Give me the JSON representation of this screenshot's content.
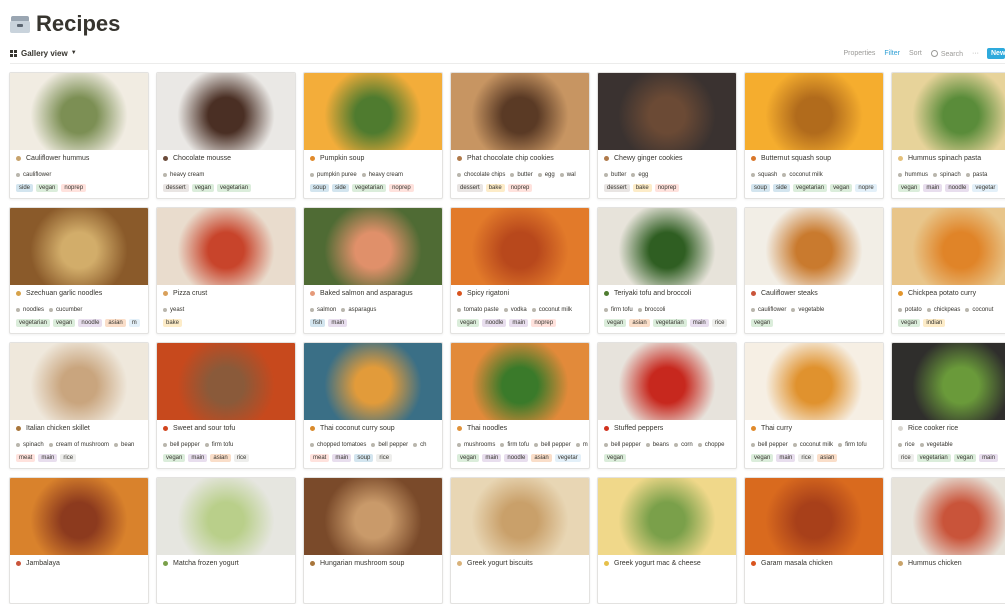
{
  "page": {
    "title": "Recipes",
    "icon": "file-cabinet-icon"
  },
  "toolbar": {
    "view_label": "Gallery view",
    "properties": "Properties",
    "filter": "Filter",
    "sort": "Sort",
    "search": "Search",
    "more": "···",
    "new": "New"
  },
  "colors": {
    "accent": "#2eaadc",
    "filter_active": "#2e9fd4"
  },
  "tag_colors": {
    "side": "#d3e5ef",
    "vegan": "#dbeddb",
    "noprep": "#ffe2dd",
    "dessert": "#e9e5e3",
    "vegetarian": "#dbeddb",
    "soup": "#d3e5ef",
    "bake": "#fdecc8",
    "noodle": "#e8deee",
    "asian": "#fadec9",
    "main": "#e8deee",
    "fish": "#d3e5ef",
    "rice": "#eeeeec",
    "indian": "#fdecc8",
    "meat": "#ffe2dd"
  },
  "cards": [
    {
      "title": "Cauliflower hummus",
      "icon_color": "#c7a36d",
      "img": [
        "#f1ece2",
        "#7c8f54"
      ],
      "ingredients": [
        "cauliflower"
      ],
      "tags": [
        "side",
        "vegan",
        "noprep"
      ]
    },
    {
      "title": "Chocolate mousse",
      "icon_color": "#6b4b3a",
      "img": [
        "#eae8e5",
        "#4a2f24"
      ],
      "ingredients": [
        "heavy cream"
      ],
      "tags": [
        "dessert",
        "vegan",
        "vegetarian"
      ]
    },
    {
      "title": "Pumpkin soup",
      "icon_color": "#e08a2c",
      "img": [
        "#f3ad3a",
        "#4f7b2f"
      ],
      "ingredients": [
        "pumpkin puree",
        "heavy cream"
      ],
      "tags": [
        "soup",
        "side",
        "vegetarian",
        "noprep"
      ]
    },
    {
      "title": "Phat chocolate chip cookies",
      "icon_color": "#b07a4a",
      "img": [
        "#c79562",
        "#5a3a25"
      ],
      "ingredients": [
        "chocolate chips",
        "butter",
        "egg",
        "wal"
      ],
      "tags": [
        "dessert",
        "bake",
        "noprep"
      ]
    },
    {
      "title": "Chewy ginger cookies",
      "icon_color": "#b07a4a",
      "img": [
        "#3a3230",
        "#6b4a35"
      ],
      "ingredients": [
        "butter",
        "egg"
      ],
      "tags": [
        "dessert",
        "bake",
        "noprep"
      ]
    },
    {
      "title": "Butternut squash soup",
      "icon_color": "#d9772b",
      "img": [
        "#f5ad2e",
        "#b16b1c"
      ],
      "ingredients": [
        "squash",
        "coconut milk"
      ],
      "tags": [
        "soup",
        "side",
        "vegetarian",
        "vegan",
        "nopre"
      ]
    },
    {
      "title": "Hummus spinach pasta",
      "icon_color": "#e4c07a",
      "img": [
        "#e7d39a",
        "#5a8c3a"
      ],
      "ingredients": [
        "hummus",
        "spinach",
        "pasta"
      ],
      "tags": [
        "vegan",
        "main",
        "noodle",
        "vegetar"
      ]
    },
    {
      "title": "Szechuan garlic noodles",
      "icon_color": "#d6a24a",
      "img": [
        "#8a5a2a",
        "#d2ad6a"
      ],
      "ingredients": [
        "noodles",
        "cucumber"
      ],
      "tags": [
        "vegetarian",
        "vegan",
        "noodle",
        "asian",
        "m"
      ]
    },
    {
      "title": "Pizza crust",
      "icon_color": "#d9a05b",
      "img": [
        "#e9dccd",
        "#c8442b"
      ],
      "ingredients": [
        "yeast"
      ],
      "tags": [
        "bake"
      ]
    },
    {
      "title": "Baked salmon and asparagus",
      "icon_color": "#e59a7a",
      "img": [
        "#4f6b34",
        "#e0906a"
      ],
      "ingredients": [
        "salmon",
        "asparagus"
      ],
      "tags": [
        "fish",
        "main"
      ]
    },
    {
      "title": "Spicy rigatoni",
      "icon_color": "#d9541e",
      "img": [
        "#e27a2a",
        "#b8481c"
      ],
      "ingredients": [
        "tomato paste",
        "vodka",
        "coconut milk"
      ],
      "tags": [
        "vegan",
        "noodle",
        "main",
        "noprep"
      ]
    },
    {
      "title": "Teriyaki tofu and broccoli",
      "icon_color": "#4f7d31",
      "img": [
        "#e7e3da",
        "#2f5e22"
      ],
      "ingredients": [
        "firm tofu",
        "broccoli"
      ],
      "tags": [
        "vegan",
        "asian",
        "vegetarian",
        "main",
        "rice"
      ]
    },
    {
      "title": "Cauliflower steaks",
      "icon_color": "#c9543a",
      "img": [
        "#f2eee6",
        "#c97a2e"
      ],
      "ingredients": [
        "cauliflower",
        "vegetable"
      ],
      "tags": [
        "vegan"
      ]
    },
    {
      "title": "Chickpea potato curry",
      "icon_color": "#e3962d",
      "img": [
        "#e8c58a",
        "#e08428"
      ],
      "ingredients": [
        "potato",
        "chickpeas",
        "coconut"
      ],
      "tags": [
        "vegan",
        "indian"
      ]
    },
    {
      "title": "Italian chicken skillet",
      "icon_color": "#a8763c",
      "img": [
        "#efe8dc",
        "#c9a57e"
      ],
      "ingredients": [
        "spinach",
        "cream of mushroom",
        "bean"
      ],
      "tags": [
        "meat",
        "main",
        "rice"
      ]
    },
    {
      "title": "Sweet and sour tofu",
      "icon_color": "#d1451e",
      "img": [
        "#c7491d",
        "#8a5a3a"
      ],
      "ingredients": [
        "bell pepper",
        "firm tofu"
      ],
      "tags": [
        "vegan",
        "main",
        "asian",
        "rice"
      ]
    },
    {
      "title": "Thai coconut curry soup",
      "icon_color": "#d98a2c",
      "img": [
        "#3a6f86",
        "#e29b3a"
      ],
      "ingredients": [
        "chopped tomatoes",
        "bell pepper",
        "ch"
      ],
      "tags": [
        "meat",
        "main",
        "soup",
        "rice"
      ]
    },
    {
      "title": "Thai noodles",
      "icon_color": "#e0923a",
      "img": [
        "#e28a3a",
        "#3a7a2a"
      ],
      "ingredients": [
        "mushrooms",
        "firm tofu",
        "bell pepper",
        "m"
      ],
      "tags": [
        "vegan",
        "main",
        "noodle",
        "asian",
        "vegetar"
      ]
    },
    {
      "title": "Stuffed peppers",
      "icon_color": "#d1321e",
      "img": [
        "#e7e3dc",
        "#c7281e"
      ],
      "ingredients": [
        "bell pepper",
        "beans",
        "corn",
        "choppe"
      ],
      "tags": [
        "vegan"
      ]
    },
    {
      "title": "Thai curry",
      "icon_color": "#e08a2c",
      "img": [
        "#f6efe4",
        "#e0922e"
      ],
      "ingredients": [
        "bell pepper",
        "coconut milk",
        "firm tofu"
      ],
      "tags": [
        "vegan",
        "main",
        "rice",
        "asian"
      ]
    },
    {
      "title": "Rice cooker rice",
      "icon_color": "#d9d6cf",
      "img": [
        "#2f2e2c",
        "#6a9a3a"
      ],
      "ingredients": [
        "rice",
        "vegetable"
      ],
      "tags": [
        "rice",
        "vegetarian",
        "vegan",
        "main"
      ]
    },
    {
      "title": "Jambalaya",
      "icon_color": "#c9543a",
      "img": [
        "#d9822c",
        "#8c3a1e"
      ],
      "ingredients": [],
      "tags": []
    },
    {
      "title": "Matcha frozen yogurt",
      "icon_color": "#7aa04a",
      "img": [
        "#e6e6e0",
        "#b9cf8a"
      ],
      "ingredients": [],
      "tags": []
    },
    {
      "title": "Hungarian mushroom soup",
      "icon_color": "#a8763c",
      "img": [
        "#7a4a2a",
        "#c99a6a"
      ],
      "ingredients": [],
      "tags": []
    },
    {
      "title": "Greek yogurt biscuits",
      "icon_color": "#d9b27a",
      "img": [
        "#e8d6b4",
        "#c9a06a"
      ],
      "ingredients": [],
      "tags": []
    },
    {
      "title": "Greek yogurt mac & cheese",
      "icon_color": "#e6c04a",
      "img": [
        "#f0d88a",
        "#7aa04a"
      ],
      "ingredients": [],
      "tags": []
    },
    {
      "title": "Garam masala chicken",
      "icon_color": "#d9541e",
      "img": [
        "#d96a1e",
        "#a8401a"
      ],
      "ingredients": [],
      "tags": []
    },
    {
      "title": "Hummus chicken",
      "icon_color": "#c9a36a",
      "img": [
        "#e7e3da",
        "#c9543a"
      ],
      "ingredients": [],
      "tags": []
    }
  ]
}
